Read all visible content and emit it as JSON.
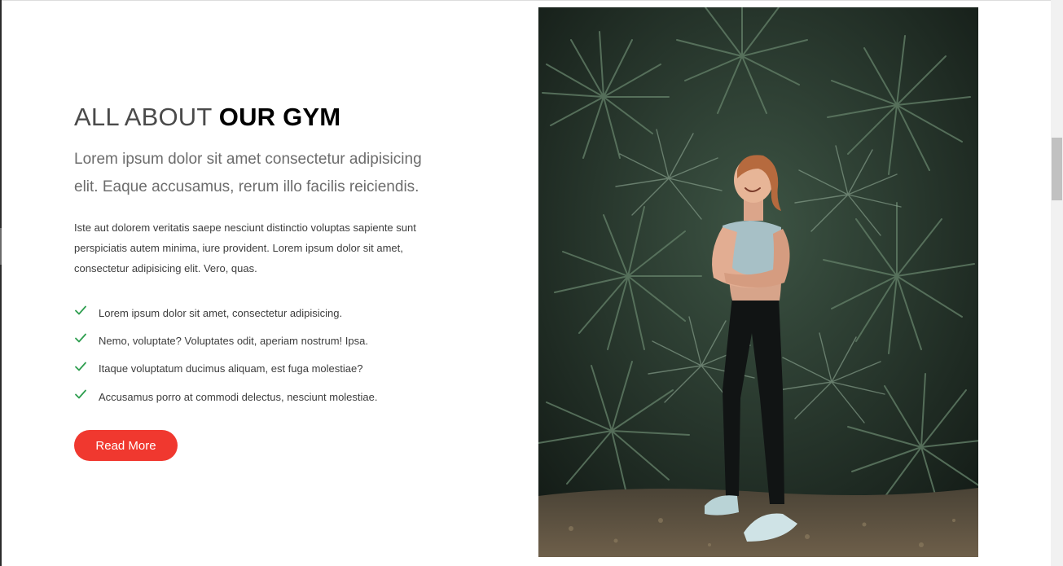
{
  "about": {
    "heading_light": "ALL ABOUT",
    "heading_bold": "OUR GYM",
    "lead": "Lorem ipsum dolor sit amet consectetur adipisicing elit. Eaque accusamus, rerum illo facilis reiciendis.",
    "body": "Iste aut dolorem veritatis saepe nesciunt distinctio voluptas sapiente sunt perspiciatis autem minima, iure provident. Lorem ipsum dolor sit amet, consectetur adipisicing elit. Vero, quas.",
    "checklist": [
      "Lorem ipsum dolor sit amet, consectetur adipisicing.",
      "Nemo, voluptate? Voluptates odit, aperiam nostrum! Ipsa.",
      "Itaque voluptatum ducimus aliquam, est fuga molestiae?",
      "Accusamus porro at commodi delectus, nesciunt molestiae."
    ],
    "button_label": "Read More"
  },
  "photo": {
    "icon": "gym-photo-woman-among-palms"
  },
  "colors": {
    "accent": "#f0382f",
    "check": "#2e9e4f",
    "heading": "#000000"
  }
}
